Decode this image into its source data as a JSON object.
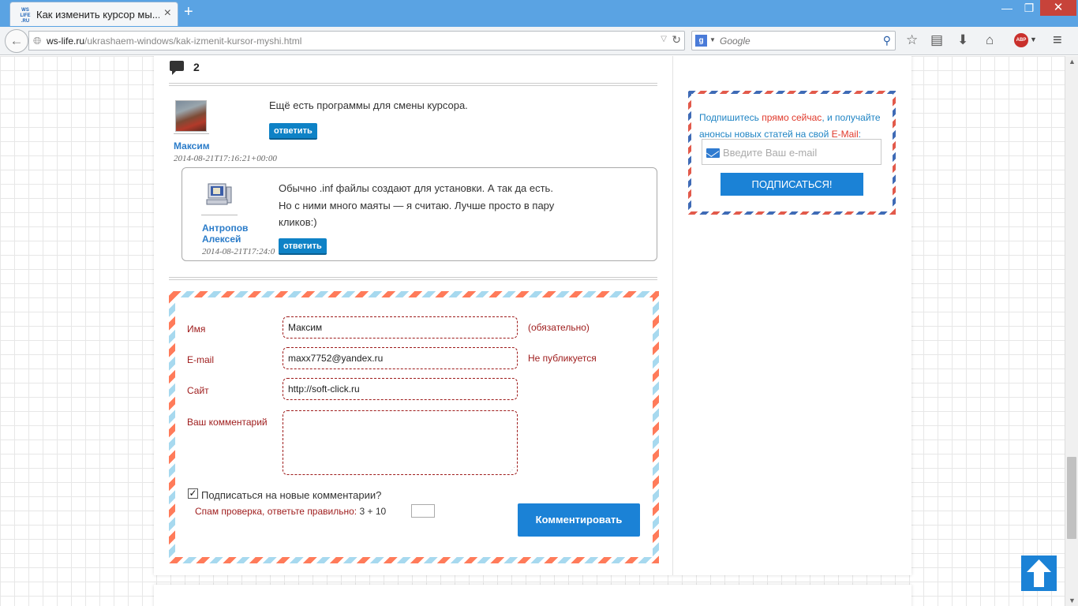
{
  "browser": {
    "tab_title": "Как изменить курсор мы...",
    "favicon_text": "WS LIFE .RU",
    "url_domain": "ws-life.ru",
    "url_path": "/ukrashaem-windows/kak-izmenit-kursor-myshi.html",
    "search_placeholder": "Google",
    "search_engine_icon": "g",
    "abp_label": "ABP"
  },
  "comments": {
    "count": "2",
    "items": [
      {
        "author": "Максим",
        "date": "2014-08-21T17:16:21+00:00",
        "text": "Ещё есть программы для смены курсора.",
        "reply_label": "ответить"
      },
      {
        "author_line1": "Антропов",
        "author_line2": "Алексей",
        "date": "2014-08-21T17:24:0",
        "text_line1": "Обычно .inf файлы создают для установки. А так да есть.",
        "text_line2": "Но с ними много маяты — я считаю. Лучше просто в пару",
        "text_line3": "кликов:)",
        "reply_label": "ответить"
      }
    ]
  },
  "form": {
    "name_label": "Имя",
    "name_value": "Максим",
    "name_note": "(обязательно)",
    "email_label": "E-mail",
    "email_value": "maxx7752@yandex.ru",
    "email_note": "Не публикуется",
    "site_label": "Сайт",
    "site_value": "http://soft-click.ru",
    "comment_label": "Ваш комментарий",
    "subscribe_label": "Подписаться на новые комментарии?",
    "subscribe_checked": true,
    "spam_label": "Спам проверка, ответьте правильно:",
    "spam_question": "3 + 10",
    "submit_label": "Комментировать"
  },
  "subscribe": {
    "text_1": "Подпишитесь ",
    "text_2": "прямо сейчас",
    "text_3": ", и получайте анонсы новых статей на свой ",
    "text_4": "E-Mail",
    "text_5": ":",
    "email_placeholder": "Введите Ваш e-mail",
    "button_label": "ПОДПИСАТЬСЯ!"
  },
  "colors": {
    "accent": "#1b82d6",
    "titlebar": "#5aa3e3",
    "label_red": "#9e1b1b",
    "link_blue": "#2b7cc9"
  }
}
